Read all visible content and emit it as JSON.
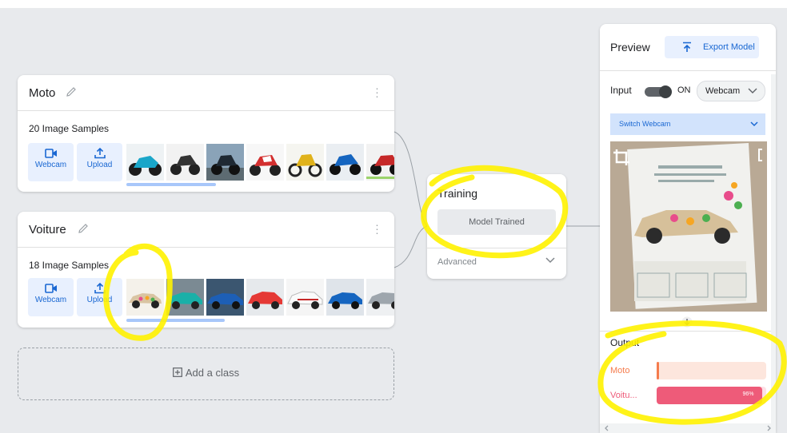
{
  "classes": [
    {
      "name": "Moto",
      "samples_label": "20 Image Samples",
      "webcam_label": "Webcam",
      "upload_label": "Upload",
      "thumbnails": [
        "motorcycle-teal",
        "motorcycle-black",
        "motorcycle-black-blue",
        "motorcycle-red-white",
        "motorcycle-dirt-yellow",
        "motorcycle-blue",
        "motorcycle-green-red"
      ]
    },
    {
      "name": "Voiture",
      "samples_label": "18 Image Samples",
      "webcam_label": "Webcam",
      "upload_label": "Upload",
      "thumbnails": [
        "car-flowers",
        "car-blue-green",
        "car-blue-sport",
        "car-red",
        "car-white",
        "car-blue-bmw",
        "car-silver"
      ]
    }
  ],
  "add_class": {
    "label": "Add a class"
  },
  "training": {
    "title": "Training",
    "button_label": "Model Trained",
    "advanced_label": "Advanced"
  },
  "preview": {
    "title": "Preview",
    "export_label": "Export Model",
    "input_label": "Input",
    "toggle_state": "ON",
    "source_select": "Webcam",
    "switch_webcam_label": "Switch Webcam",
    "output_label": "Output",
    "outputs": [
      {
        "label": "Moto",
        "percent": 2,
        "percent_label": "",
        "color": "#f57c4d",
        "track": "#fde6dd"
      },
      {
        "label": "Voitu...",
        "percent": 96,
        "percent_label": "96%",
        "color": "#ee5b79",
        "track": "#fde0e6"
      }
    ]
  },
  "colors": {
    "accent_blue": "#1967d2",
    "light_blue": "#e8f0fe",
    "highlight_yellow": "#fff200"
  }
}
